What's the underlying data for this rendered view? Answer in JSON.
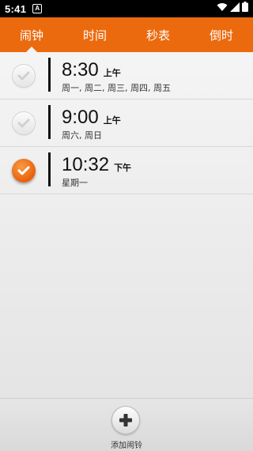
{
  "status_bar": {
    "time": "5:41",
    "notification_badge": "A"
  },
  "tabs": [
    {
      "label": "闹钟",
      "active": true
    },
    {
      "label": "时间",
      "active": false
    },
    {
      "label": "秒表",
      "active": false
    },
    {
      "label": "倒时",
      "active": false
    }
  ],
  "alarms": [
    {
      "time": "8:30",
      "ampm": "上午",
      "days": "周一, 周二, 周三, 周四, 周五",
      "enabled": false
    },
    {
      "time": "9:00",
      "ampm": "上午",
      "days": "周六, 周日",
      "enabled": false
    },
    {
      "time": "10:32",
      "ampm": "下午",
      "days": "星期一",
      "enabled": true
    }
  ],
  "add_alarm": {
    "label": "添加闹铃"
  },
  "colors": {
    "accent": "#ec6a0e",
    "status_bar": "#000000"
  }
}
